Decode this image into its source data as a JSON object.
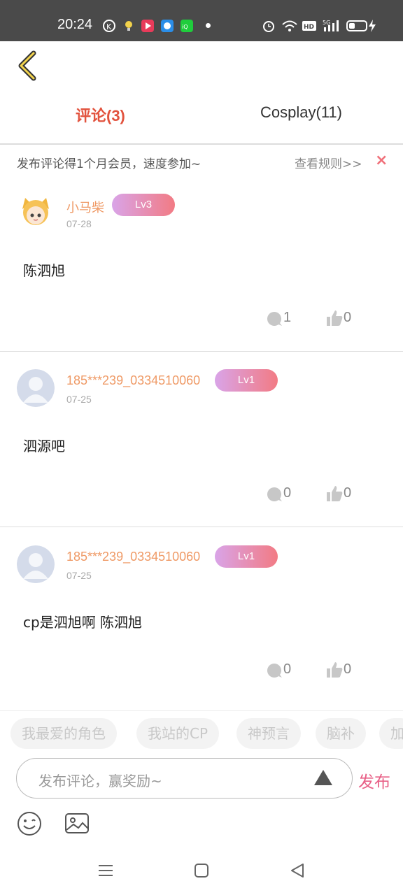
{
  "status_bar": {
    "time": "20:24"
  },
  "tabs": [
    {
      "label": "评论(3)",
      "active": true
    },
    {
      "label": "Cosplay(11)",
      "active": false
    }
  ],
  "notice": {
    "text": "发布评论得1个月会员，速度参加~",
    "link": "查看规则>>",
    "close": "×"
  },
  "comments": [
    {
      "username": "小马柴",
      "level": "Lv3",
      "date": "07-28",
      "text": "陈泗旭",
      "replies": "1",
      "likes": "0"
    },
    {
      "username": "185***239_0334510060",
      "level": "Lv1",
      "date": "07-25",
      "text": "泗源吧",
      "replies": "0",
      "likes": "0"
    },
    {
      "username": "185***239_0334510060",
      "level": "Lv1",
      "date": "07-25",
      "text": "cp是泗旭啊 陈泗旭",
      "replies": "0",
      "likes": "0"
    }
  ],
  "quick_tags": [
    "我最爱的角色",
    "我站的CP",
    "神预言",
    "脑补",
    "加"
  ],
  "input": {
    "placeholder": "发布评论，赢奖励~",
    "publish_label": "发布"
  },
  "colors": {
    "accent": "#e2533e",
    "username": "#ef9a66",
    "publish": "#e85f86"
  }
}
